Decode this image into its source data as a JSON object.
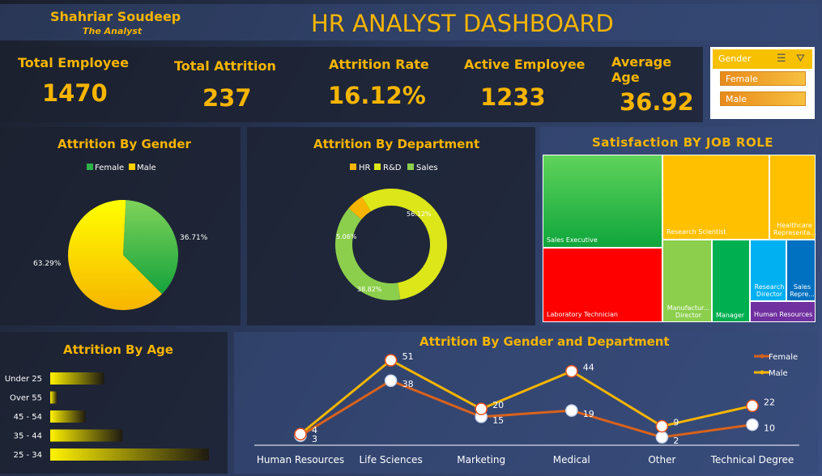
{
  "header": {
    "author": "Shahriar Soudeep",
    "author_subtitle": "The Analyst",
    "title": "HR ANALYST DASHBOARD"
  },
  "kpis": {
    "total_employee": {
      "label": "Total Employee",
      "value": "1470"
    },
    "total_attrition": {
      "label": "Total Attrition",
      "value": "237"
    },
    "attrition_rate": {
      "label": "Attrition Rate",
      "value": "16.12%"
    },
    "active_employee": {
      "label": "Active Employee",
      "value": "1233"
    },
    "average_age": {
      "label": "Average Age",
      "value": "36.92"
    }
  },
  "slicer": {
    "title": "Gender",
    "items": [
      "Female",
      "Male"
    ]
  },
  "colors": {
    "gold": "#f7b500",
    "green": "#2db34a",
    "yellow": "#ffd000",
    "lime": "#dce619",
    "light_green": "#8ccf4c",
    "orange": "#d9621c",
    "red": "#ff0000"
  },
  "chart_data": [
    {
      "type": "pie",
      "title": "Attrition By Gender",
      "legend": [
        "Female",
        "Male"
      ],
      "categories": [
        "Female",
        "Male"
      ],
      "values": [
        36.71,
        63.29
      ],
      "labels": [
        "36.71%",
        "63.29%"
      ],
      "legend_position": "top"
    },
    {
      "type": "pie",
      "title": "Attrition By Department",
      "legend": [
        "HR",
        "R&D",
        "Sales"
      ],
      "categories": [
        "HR",
        "R&D",
        "Sales"
      ],
      "values": [
        5.06,
        56.12,
        38.82
      ],
      "labels": [
        "5.06%",
        "56.12%",
        "38.82%"
      ],
      "legend_position": "top"
    },
    {
      "type": "treemap",
      "title": "Satisfaction BY JOB ROLE",
      "categories": [
        "Sales Executive",
        "Research Scientist",
        "Healthcare Representa...",
        "Laboratory Technician",
        "Manufactur... Director",
        "Manager",
        "Research Director",
        "Sales Repre...",
        "Human Resources"
      ]
    },
    {
      "type": "bar",
      "title": "Attrition By Age",
      "categories": [
        "Under 25",
        "Over 55",
        "45 - 54",
        "35 - 44",
        "25 - 34"
      ],
      "values": [
        38,
        5,
        25,
        51,
        112
      ]
    },
    {
      "type": "line",
      "title": "Attrition By Gender and Department",
      "categories": [
        "Human Resources",
        "Life Sciences",
        "Marketing",
        "Medical",
        "Other",
        "Technical Degree"
      ],
      "series": [
        {
          "name": "Female",
          "values": [
            3,
            38,
            15,
            19,
            2,
            10
          ]
        },
        {
          "name": "Male",
          "values": [
            4,
            51,
            20,
            44,
            9,
            22
          ]
        }
      ],
      "legend_position": "top-right",
      "ylim": [
        0,
        60
      ]
    }
  ]
}
